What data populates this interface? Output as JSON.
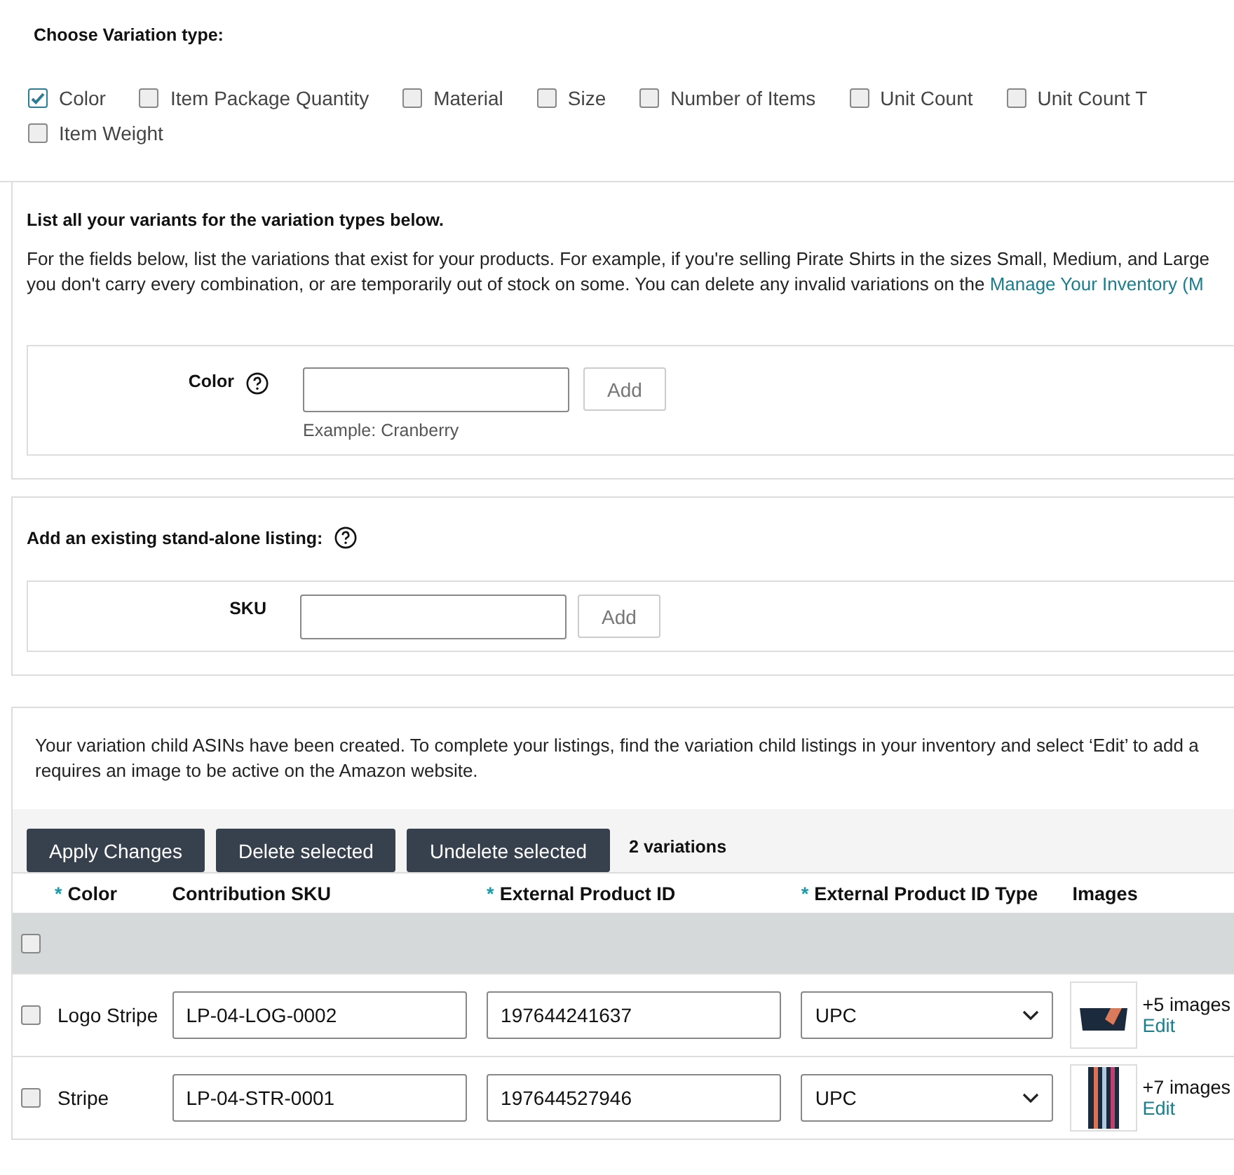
{
  "variation_type": {
    "title": "Choose Variation type:",
    "options": [
      {
        "label": "Color",
        "checked": true
      },
      {
        "label": "Item Package Quantity",
        "checked": false
      },
      {
        "label": "Material",
        "checked": false
      },
      {
        "label": "Size",
        "checked": false
      },
      {
        "label": "Number of Items",
        "checked": false
      },
      {
        "label": "Unit Count",
        "checked": false
      },
      {
        "label": "Unit Count T",
        "checked": false
      },
      {
        "label": "Item Weight",
        "checked": false
      }
    ]
  },
  "variants": {
    "title": "List all your variants for the variation types below.",
    "text": "For the fields below, list the variations that exist for your products. For example, if you're selling Pirate Shirts in the sizes Small, Medium, and Large you don't carry every combination, or are temporarily out of stock on some. You can delete any invalid variations on the ",
    "link": "Manage Your Inventory (M",
    "field_label": "Color",
    "add_button": "Add",
    "example": "Example: Cranberry"
  },
  "standalone": {
    "title": "Add an existing stand-alone listing:",
    "field_label": "SKU",
    "add_button": "Add"
  },
  "children": {
    "text": "Your variation child ASINs have been created. To complete your listings, find the variation child listings in your inventory and select ‘Edit’ to add a requires an image to be active on the Amazon website.",
    "buttons": [
      "Apply Changes",
      "Delete selected",
      "Undelete selected"
    ],
    "count": "2 variations",
    "columns": [
      {
        "marker": "*",
        "label": "Color"
      },
      {
        "label": "Contribution SKU"
      },
      {
        "marker": "*",
        "label": "External Product ID"
      },
      {
        "marker": "*",
        "label": "External Product ID Type"
      },
      {
        "label": "Images"
      }
    ],
    "select_all": {
      "checked": false
    },
    "rows": [
      {
        "checked": false,
        "variation": "Logo Stripe",
        "sku": "LP-04-LOG-0002",
        "product_id": "197644241637",
        "id_type": "UPC",
        "kind": "logo",
        "images": "+5 images",
        "edit": "Edit"
      },
      {
        "checked": false,
        "variation": "Stripe",
        "sku": "LP-04-STR-0001",
        "product_id": "197644527946",
        "id_type": "UPC",
        "kind": "stripe",
        "images": "+7 images",
        "edit": "Edit"
      }
    ]
  }
}
